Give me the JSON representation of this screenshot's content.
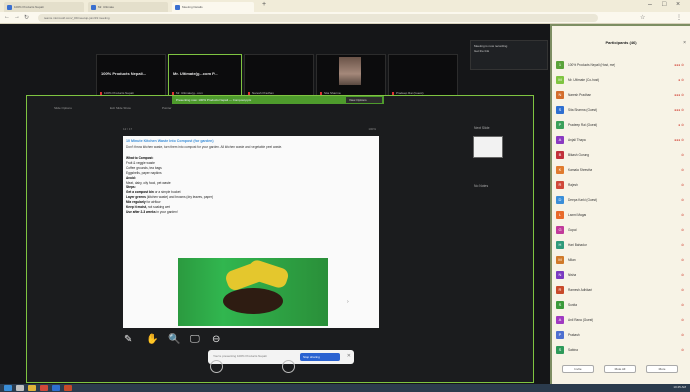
{
  "browser": {
    "tabs": [
      {
        "label": "100% Products Nepali"
      },
      {
        "label": "Mr. Ultimate"
      },
      {
        "label": "Meeting Details"
      }
    ],
    "url": "teams.microsoft.com/_#/l/meetup-join/19:meeting"
  },
  "meeting": {
    "tiles": [
      {
        "name": "100% Products Nepali...",
        "sub": "100% Products Nepali"
      },
      {
        "name": "Mr. Ultimate(g...com P...",
        "sub": "Mr. Ultimate(g...com"
      },
      {
        "name": "",
        "sub": "Naresh Pradhan"
      },
      {
        "name": "",
        "sub": "Sita Sharma"
      },
      {
        "name": "",
        "sub": "Pradeep Rai (Guest)"
      }
    ],
    "notification": {
      "line1": "Meeting is now recording",
      "line2": "Get the link"
    },
    "share_label": "Presenting now: 100% Products Nepali — Compost.pptx",
    "view_options": "View Options",
    "pp_toolbar": [
      "Slide Options",
      "Exit Slide Show",
      "Pointer"
    ],
    "doc_topbar": {
      "left": "12 / 17",
      "right": "100%"
    },
    "slide": {
      "title": "10 Minute Kitchen Waste Into Compost (for garden)",
      "intro": "Don't throw kitchen waste, turn them into compost for your garden. All kitchen waste and vegetable peel waste.",
      "lines": [
        {
          "b": "What to Compost:",
          "t": ""
        },
        {
          "b": "",
          "t": "Fruit & veggie waste"
        },
        {
          "b": "",
          "t": "Coffee grounds, tea bags"
        },
        {
          "b": "",
          "t": "Eggshells, paper napkins"
        },
        {
          "b": "Avoid:",
          "t": ""
        },
        {
          "b": "",
          "t": "Meat, dairy, oily food, pet waste"
        },
        {
          "b": "Steps:",
          "t": ""
        },
        {
          "b": "Get a compost bin",
          "t": " or a simple bucket"
        },
        {
          "b": "Layer greens",
          "t": " (kitchen waste) and browns (dry leaves, paper)"
        },
        {
          "b": "Mix regularly",
          "t": " for airflow"
        },
        {
          "b": "Keep it moist,",
          "t": " not soaking wet"
        },
        {
          "b": "Use after 2-3 weeks",
          "t": " in your garden!"
        }
      ]
    },
    "right_col": {
      "top": "Next Slide",
      "bottom": "No Notes"
    },
    "tools": [
      "✎",
      "✋",
      "🔍",
      "🖵",
      "⊖"
    ],
    "stop_bar": {
      "text": "You're presenting 100% Products Nepali",
      "button": "Stop sharing",
      "close": "✕"
    }
  },
  "participants": {
    "title": "Participants (46)",
    "rows": [
      {
        "name": "100% Products Nepali (Host, me)",
        "status": "●●● ⊘",
        "color": "#5aa33a",
        "init": "1"
      },
      {
        "name": "Mr. Ultimate (Co-host)",
        "status": "● ⊘",
        "color": "#7fc441",
        "init": "M"
      },
      {
        "name": "Naresh Pradhan",
        "status": "●●● ⊘",
        "color": "#d36d2c",
        "init": "N"
      },
      {
        "name": "Sita Sharma (Guest)",
        "status": "●●● ⊘",
        "color": "#2e6fd0",
        "init": "S"
      },
      {
        "name": "Pradeep Rai (Guest)",
        "status": "● ⊘",
        "color": "#3aa05a",
        "init": "P"
      },
      {
        "name": "Anjali Thapa",
        "status": "●●● ⊘",
        "color": "#8a3ac1",
        "init": "A"
      },
      {
        "name": "Bikash Gurung",
        "status": "⊘",
        "color": "#c1303a",
        "init": "B"
      },
      {
        "name": "Kamala Shrestha",
        "status": "⊘",
        "color": "#e07b2e",
        "init": "K"
      },
      {
        "name": "Rajesh",
        "status": "⊘",
        "color": "#d0483a",
        "init": "R"
      },
      {
        "name": "Deepa Karki (Guest)",
        "status": "⊘",
        "color": "#3a8ed8",
        "init": "D"
      },
      {
        "name": "Laxmi Magar",
        "status": "⊘",
        "color": "#e86a2a",
        "init": "L"
      },
      {
        "name": "Gopal",
        "status": "⊘",
        "color": "#c13a9a",
        "init": "G"
      },
      {
        "name": "Hari Bahadur",
        "status": "⊘",
        "color": "#2e9a7a",
        "init": "H"
      },
      {
        "name": "Milan",
        "status": "⊘",
        "color": "#d07a2a",
        "init": "M"
      },
      {
        "name": "Nisha",
        "status": "⊘",
        "color": "#7a3ac1",
        "init": "N"
      },
      {
        "name": "Ramesh Adhikari",
        "status": "⊘",
        "color": "#c84a2a",
        "init": "R"
      },
      {
        "name": "Sunita",
        "status": "⊘",
        "color": "#3a9a3a",
        "init": "S"
      },
      {
        "name": "Anil Rana (Guest)",
        "status": "⊘",
        "color": "#a03ac1",
        "init": "A"
      },
      {
        "name": "Prakash",
        "status": "⊘",
        "color": "#4e6fd0",
        "init": "P"
      },
      {
        "name": "Sabina",
        "status": "⊘",
        "color": "#2e9a5a",
        "init": "S"
      }
    ],
    "footer": [
      "Invite",
      "Mute All",
      "More"
    ]
  },
  "taskbar": {
    "time": "10:45 AM"
  }
}
